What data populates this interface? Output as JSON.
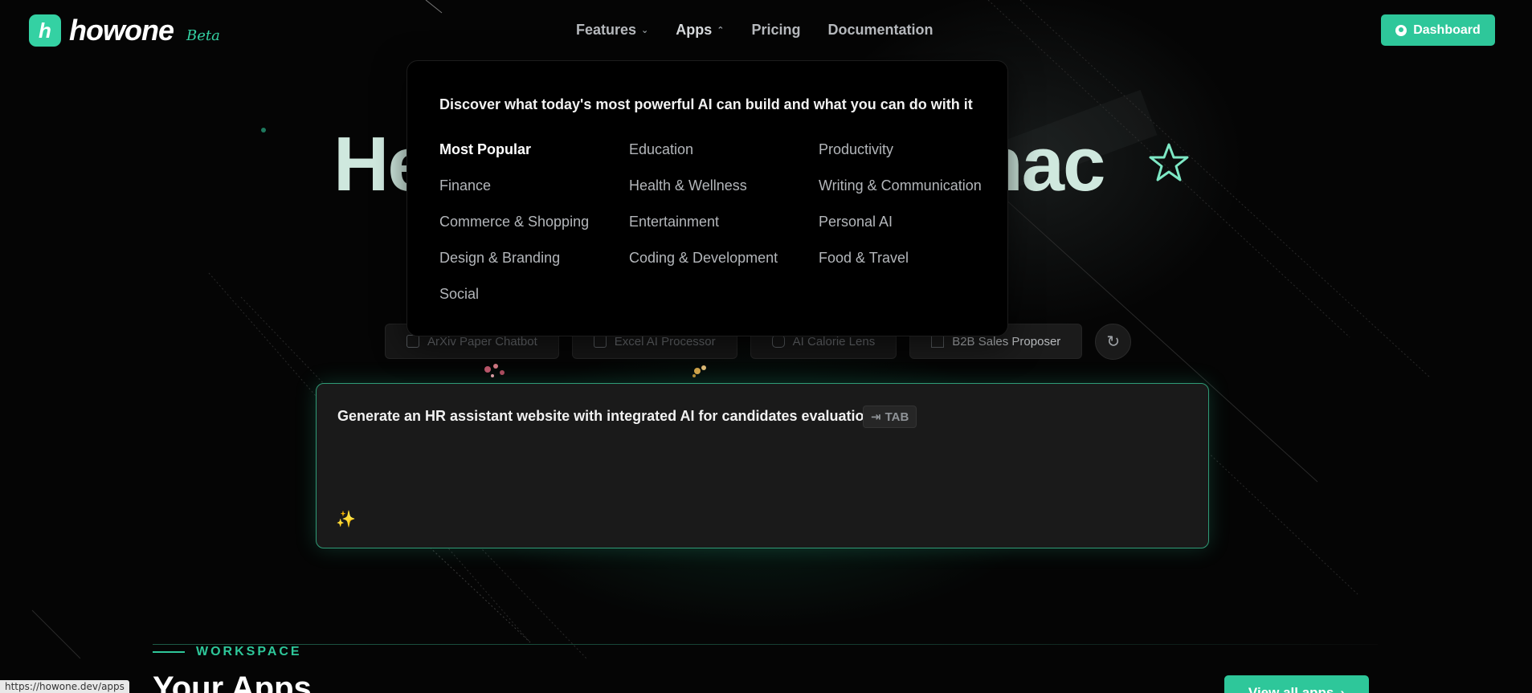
{
  "brand": {
    "logo_mark": "h",
    "name": "howone",
    "beta": "Beta"
  },
  "nav": {
    "items": [
      {
        "label": "Features",
        "chevron": "chevron-down-icon"
      },
      {
        "label": "Apps",
        "chevron": "chevron-up-icon"
      },
      {
        "label": "Pricing"
      },
      {
        "label": "Documentation"
      }
    ],
    "dashboard_label": "Dashboard"
  },
  "hero": {
    "title_left": "He",
    "title_right": "nac"
  },
  "apps_dropdown": {
    "heading": "Discover what today's most powerful AI can build and what you can do with it",
    "columns": [
      [
        "Most Popular",
        "Finance",
        "Commerce & Shopping",
        "Design & Branding",
        "Social"
      ],
      [
        "Education",
        "Health & Wellness",
        "Entertainment",
        "Coding & Development"
      ],
      [
        "Productivity",
        "Writing & Communication",
        "Personal AI",
        "Food & Travel"
      ]
    ]
  },
  "chips": [
    {
      "label": "ArXiv Paper Chatbot",
      "icon": "document-icon"
    },
    {
      "label": "Excel AI Processor",
      "icon": "spreadsheet-icon"
    },
    {
      "label": "AI Calorie Lens",
      "icon": "camera-icon"
    },
    {
      "label": "B2B Sales Proposer",
      "icon": "chart-icon"
    }
  ],
  "prompt": {
    "placeholder": "Generate an HR assistant website with integrated AI for candidates evaluation...",
    "tab_hint": "TAB"
  },
  "workspace": {
    "label": "WORKSPACE",
    "title": "Your Apps",
    "view_all": "View all apps"
  },
  "status_bar": {
    "url": "https://howone.dev/apps"
  },
  "colors": {
    "accent": "#2ec79a",
    "background": "#050505",
    "dropdown_bg": "#000000"
  }
}
